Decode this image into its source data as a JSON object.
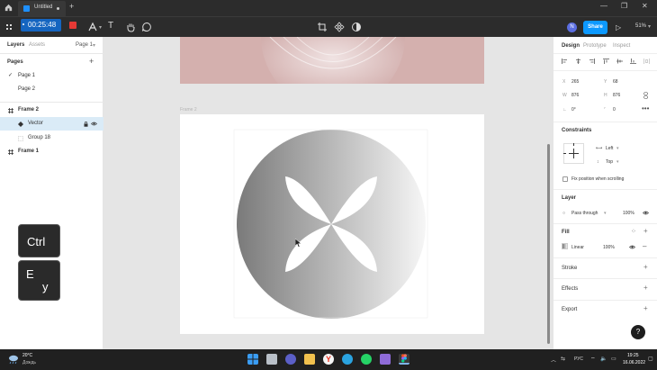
{
  "titlebar": {
    "tab_title": "Untitled"
  },
  "toolbar": {
    "timer": "00:25:48",
    "avatar_initial": "N",
    "share_label": "Share",
    "zoom": "51%"
  },
  "left_panel": {
    "tabs": [
      "Layers",
      "Assets"
    ],
    "page_selector": "Page 1",
    "pages_heading": "Pages",
    "pages": [
      "Page 1",
      "Page 2"
    ],
    "layers": [
      {
        "name": "Frame 2",
        "level": 0,
        "kind": "frame"
      },
      {
        "name": "Vector",
        "level": 1,
        "kind": "vector",
        "selected": true
      },
      {
        "name": "Group 18",
        "level": 1,
        "kind": "group"
      },
      {
        "name": "Frame 1",
        "level": 0,
        "kind": "frame"
      }
    ]
  },
  "canvas": {
    "frame2_label": "Frame 2"
  },
  "keys": {
    "key1": "Ctrl",
    "key2_top": "E",
    "key2_bottom": "у"
  },
  "right_panel": {
    "tabs": [
      "Design",
      "Prototype",
      "Inspect"
    ],
    "x_label": "X",
    "x_value": "265",
    "y_label": "Y",
    "y_value": "68",
    "w_label": "W",
    "w_value": "876",
    "h_label": "H",
    "h_value": "876",
    "rotation": "0°",
    "radius": "0",
    "constraints_title": "Constraints",
    "constraint_h": "Left",
    "constraint_v": "Top",
    "fix_position": "Fix position when scrolling",
    "layer_title": "Layer",
    "blend_mode": "Pass through",
    "layer_opacity": "100%",
    "fill_title": "Fill",
    "fill_type": "Linear",
    "fill_opacity": "100%",
    "stroke_title": "Stroke",
    "effects_title": "Effects",
    "export_title": "Export",
    "help": "?"
  },
  "taskbar": {
    "temperature": "20°C",
    "weather_text": "Дождь",
    "lang": "РУС",
    "time": "19:25",
    "date": "16.06.2022"
  },
  "colors": {
    "accent": "#0d99ff",
    "toolbar_bg": "#2c2c2c",
    "canvas_bg": "#e5e5e5",
    "frame1_fill": "#d4b0ae"
  }
}
